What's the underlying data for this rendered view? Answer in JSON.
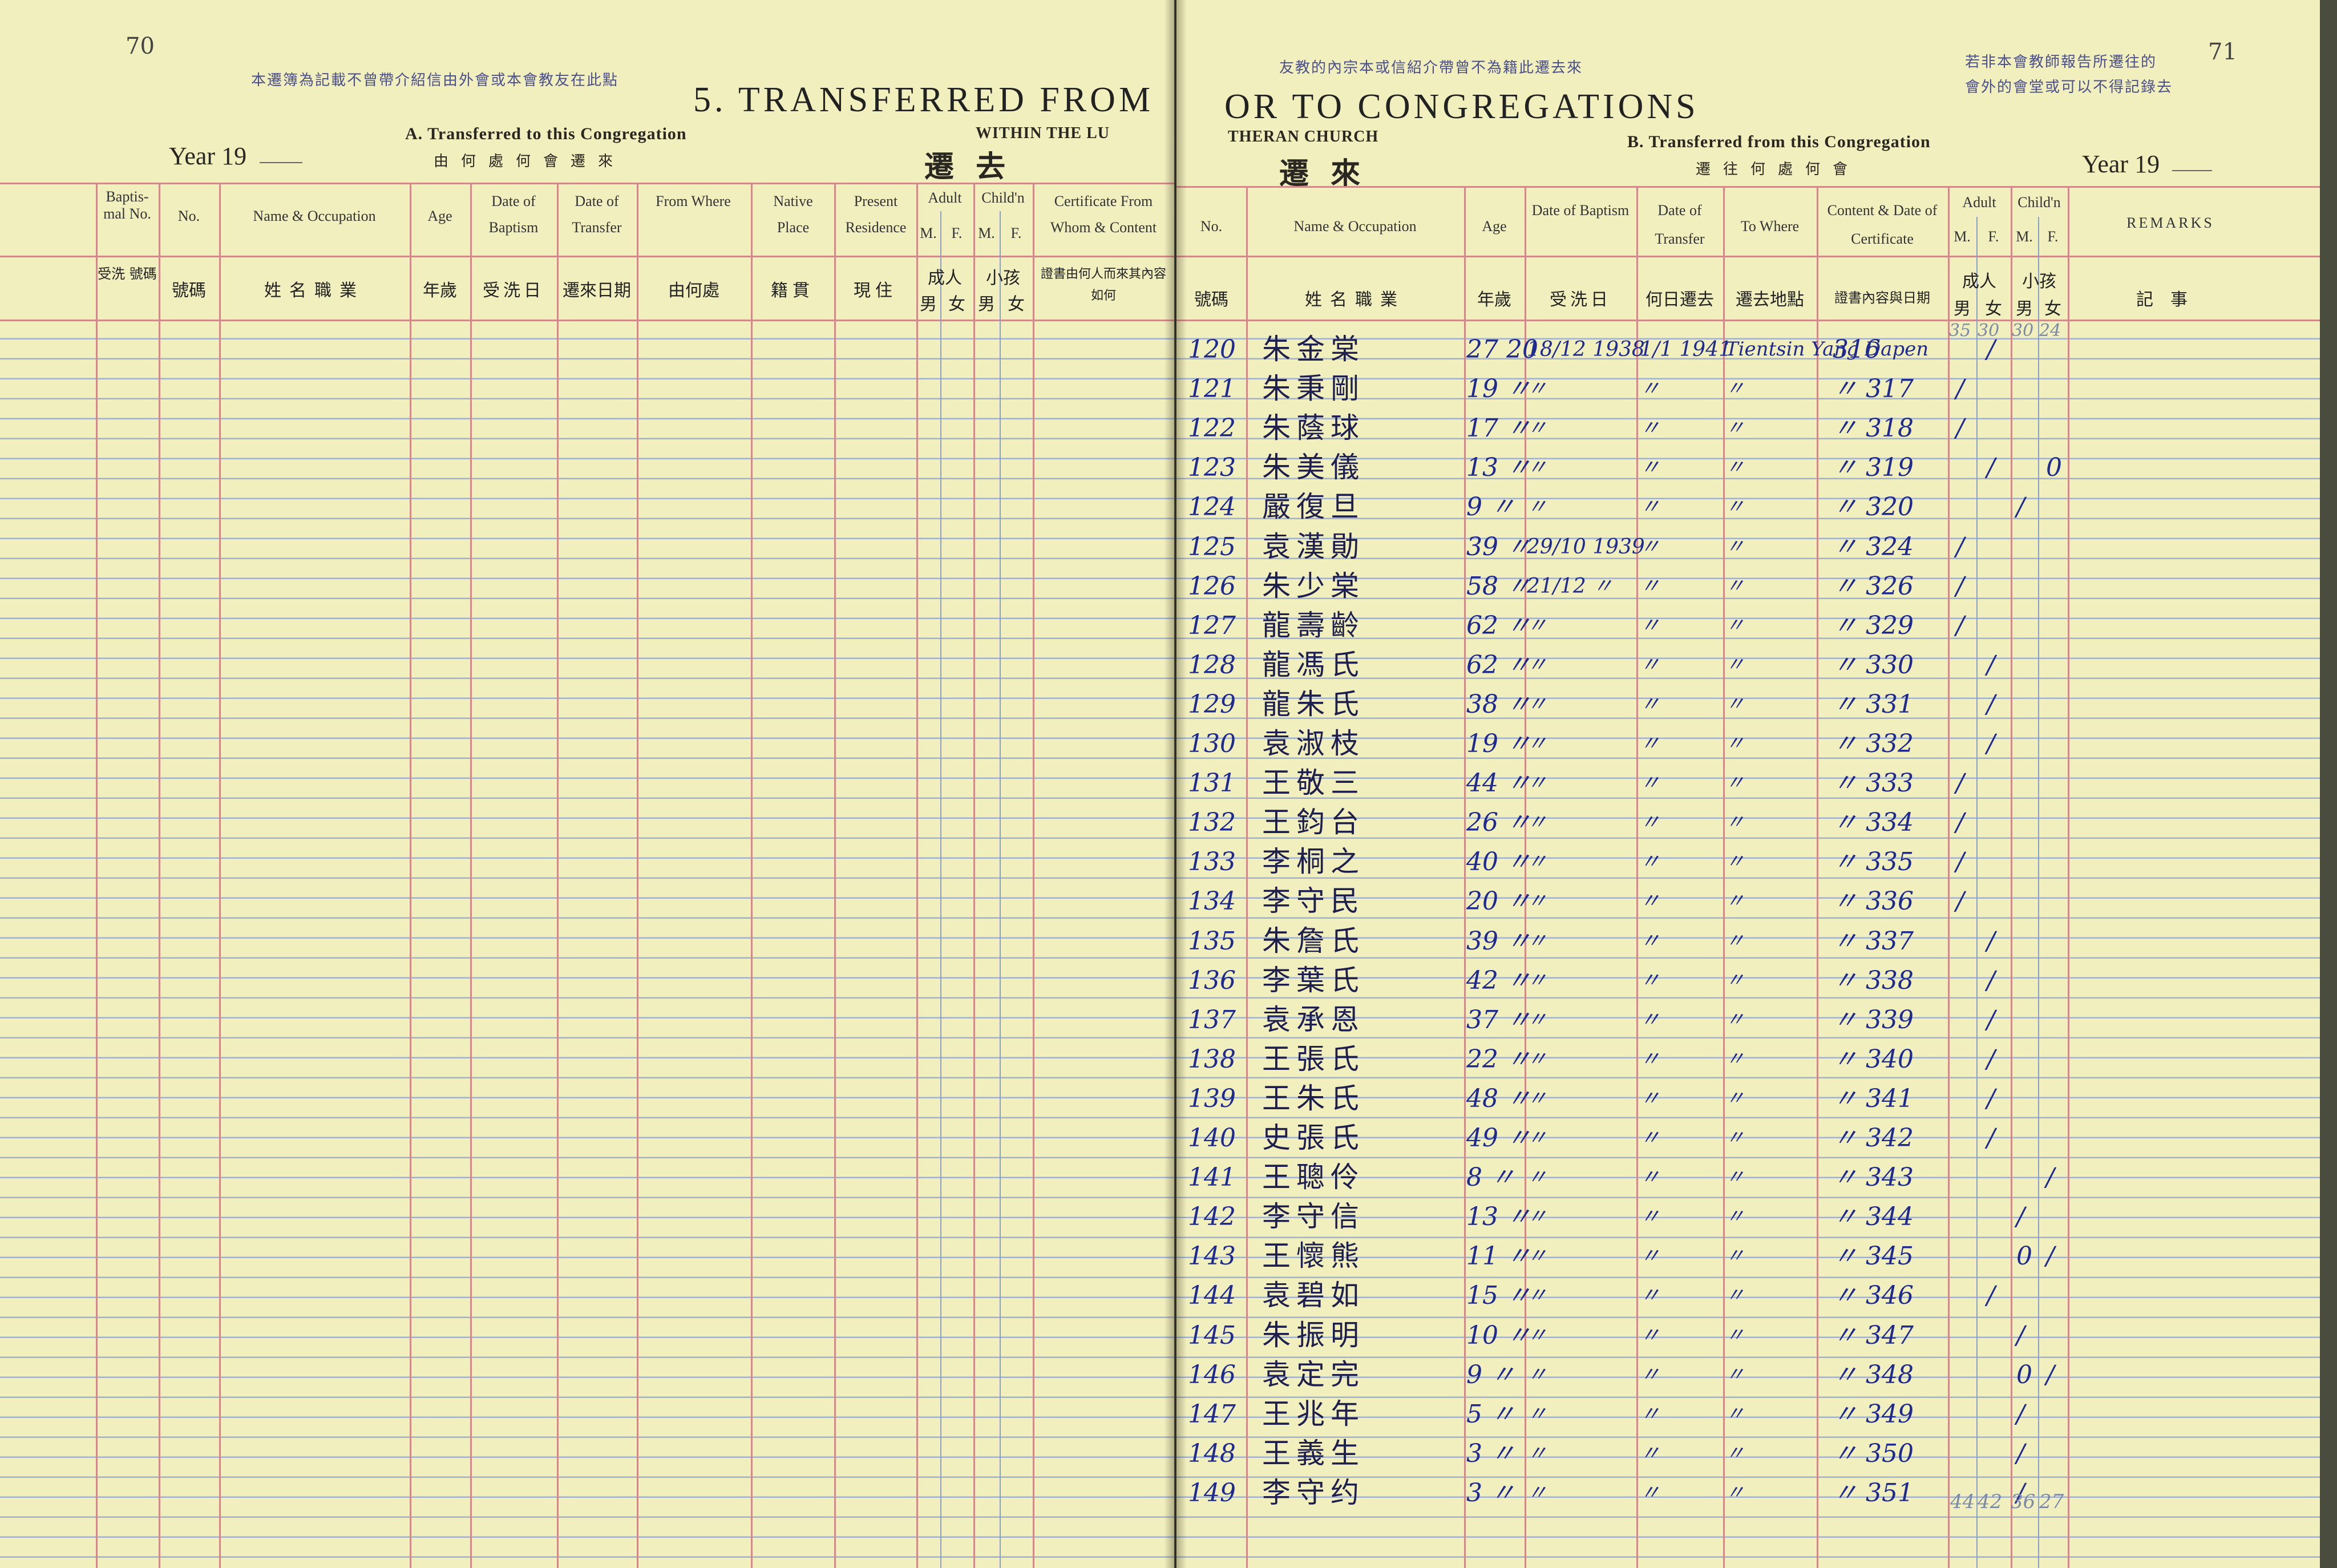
{
  "pages": {
    "left_number": "70",
    "right_number": "71"
  },
  "stamps": {
    "left": "本遷簿為記載不曾帶介紹信由外會或本會教友在此點",
    "middle": "友教的內宗本或信紹介帶曾不為籍此遷去來",
    "right_1": "若非本會教師報告所遷往的",
    "right_2": "會外的會堂或可以不得記錄去"
  },
  "title": {
    "left": "5. TRANSFERRED FROM",
    "right": "OR TO CONGREGATIONS",
    "within_left": "WITHIN THE LU",
    "within_right": "THERAN CHURCH"
  },
  "section_a": {
    "label": "A. Transferred to this Congregation",
    "label_cn": "由何處何會遷來",
    "big_cn": "遷 去"
  },
  "section_b": {
    "label": "B. Transferred from this Congregation",
    "label_cn": "遷往何處何會",
    "big_cn": "遷 來"
  },
  "year_label": "Year 19",
  "left_headers": [
    {
      "en": "Baptis- mal No.",
      "cn": "受洗 號碼"
    },
    {
      "en": "No.",
      "cn": "號碼"
    },
    {
      "en": "Name & Occupation",
      "cn": "姓名職業"
    },
    {
      "en": "Age",
      "cn": "年歲"
    },
    {
      "en": "Date of Baptism",
      "cn": "受洗日"
    },
    {
      "en": "Date of Transfer",
      "cn": "遷來日期"
    },
    {
      "en": "From Where",
      "cn": "由何處"
    },
    {
      "en": "Native Place",
      "cn": "籍貫"
    },
    {
      "en": "Present Residence",
      "cn": "現住"
    },
    {
      "en": "Adult",
      "cn": "成人"
    },
    {
      "en": "Child'n",
      "cn": "小孩"
    },
    {
      "en": "Certificate From Whom & Content",
      "cn": "證書由何人而來其內容如何"
    }
  ],
  "right_headers": [
    {
      "en": "No.",
      "cn": "號碼"
    },
    {
      "en": "Name & Occupation",
      "cn": "姓名職業"
    },
    {
      "en": "Age",
      "cn": "年歲"
    },
    {
      "en": "Date of Baptism",
      "cn": "受洗日"
    },
    {
      "en": "Date of Transfer",
      "cn": "何日遷去"
    },
    {
      "en": "To Where",
      "cn": "遷去地點"
    },
    {
      "en": "Content & Date of Certificate",
      "cn": "證書內容與日期"
    },
    {
      "en": "Adult",
      "cn": "成人"
    },
    {
      "en": "Child'n",
      "cn": "小孩"
    },
    {
      "en": "REMARKS",
      "cn": "記事"
    }
  ],
  "mf": {
    "m": "M.",
    "f": "F.",
    "male_cn": "男",
    "female_cn": "女"
  },
  "top_tally": [
    "35",
    "30",
    "30",
    "24"
  ],
  "entries": [
    {
      "no": "120",
      "name": "朱金棠",
      "age": "27 20",
      "bap": "18/12 1938",
      "trans": "1/1 1941",
      "to": "Tientsin Yang Dapen",
      "cert": "316",
      "am": "",
      "af": "/",
      "cm": "",
      "cf": ""
    },
    {
      "no": "121",
      "name": "朱秉剛",
      "age": "19 〃",
      "bap": "〃",
      "trans": "〃",
      "to": "〃",
      "cert": "〃 317",
      "am": "/",
      "af": "",
      "cm": "",
      "cf": ""
    },
    {
      "no": "122",
      "name": "朱蔭球",
      "age": "17 〃",
      "bap": "〃",
      "trans": "〃",
      "to": "〃",
      "cert": "〃 318",
      "am": "/",
      "af": "",
      "cm": "",
      "cf": ""
    },
    {
      "no": "123",
      "name": "朱美儀",
      "age": "13 〃",
      "bap": "〃",
      "trans": "〃",
      "to": "〃",
      "cert": "〃 319",
      "am": "",
      "af": "/",
      "cm": "",
      "cf": "0"
    },
    {
      "no": "124",
      "name": "嚴復旦",
      "age": "9 〃",
      "bap": "〃",
      "trans": "〃",
      "to": "〃",
      "cert": "〃 320",
      "am": "",
      "af": "",
      "cm": "/",
      "cf": ""
    },
    {
      "no": "125",
      "name": "袁漢勛",
      "age": "39 〃",
      "bap": "29/10 1939",
      "trans": "〃",
      "to": "〃",
      "cert": "〃 324",
      "am": "/",
      "af": "",
      "cm": "",
      "cf": ""
    },
    {
      "no": "126",
      "name": "朱少棠",
      "age": "58 〃",
      "bap": "21/12 〃",
      "trans": "〃",
      "to": "〃",
      "cert": "〃 326",
      "am": "/",
      "af": "",
      "cm": "",
      "cf": ""
    },
    {
      "no": "127",
      "name": "龍壽齡",
      "age": "62 〃",
      "bap": "〃",
      "trans": "〃",
      "to": "〃",
      "cert": "〃 329",
      "am": "/",
      "af": "",
      "cm": "",
      "cf": ""
    },
    {
      "no": "128",
      "name": "龍馮氏",
      "age": "62 〃",
      "bap": "〃",
      "trans": "〃",
      "to": "〃",
      "cert": "〃 330",
      "am": "",
      "af": "/",
      "cm": "",
      "cf": ""
    },
    {
      "no": "129",
      "name": "龍朱氏",
      "age": "38 〃",
      "bap": "〃",
      "trans": "〃",
      "to": "〃",
      "cert": "〃 331",
      "am": "",
      "af": "/",
      "cm": "",
      "cf": ""
    },
    {
      "no": "130",
      "name": "袁淑枝",
      "age": "19 〃",
      "bap": "〃",
      "trans": "〃",
      "to": "〃",
      "cert": "〃 332",
      "am": "",
      "af": "/",
      "cm": "",
      "cf": ""
    },
    {
      "no": "131",
      "name": "王敬三",
      "age": "44 〃",
      "bap": "〃",
      "trans": "〃",
      "to": "〃",
      "cert": "〃 333",
      "am": "/",
      "af": "",
      "cm": "",
      "cf": ""
    },
    {
      "no": "132",
      "name": "王鈞台",
      "age": "26 〃",
      "bap": "〃",
      "trans": "〃",
      "to": "〃",
      "cert": "〃 334",
      "am": "/",
      "af": "",
      "cm": "",
      "cf": ""
    },
    {
      "no": "133",
      "name": "李桐之",
      "age": "40 〃",
      "bap": "〃",
      "trans": "〃",
      "to": "〃",
      "cert": "〃 335",
      "am": "/",
      "af": "",
      "cm": "",
      "cf": ""
    },
    {
      "no": "134",
      "name": "李守民",
      "age": "20 〃",
      "bap": "〃",
      "trans": "〃",
      "to": "〃",
      "cert": "〃 336",
      "am": "/",
      "af": "",
      "cm": "",
      "cf": ""
    },
    {
      "no": "135",
      "name": "朱詹氏",
      "age": "39 〃",
      "bap": "〃",
      "trans": "〃",
      "to": "〃",
      "cert": "〃 337",
      "am": "",
      "af": "/",
      "cm": "",
      "cf": ""
    },
    {
      "no": "136",
      "name": "李葉氏",
      "age": "42 〃",
      "bap": "〃",
      "trans": "〃",
      "to": "〃",
      "cert": "〃 338",
      "am": "",
      "af": "/",
      "cm": "",
      "cf": ""
    },
    {
      "no": "137",
      "name": "袁承恩",
      "age": "37 〃",
      "bap": "〃",
      "trans": "〃",
      "to": "〃",
      "cert": "〃 339",
      "am": "",
      "af": "/",
      "cm": "",
      "cf": ""
    },
    {
      "no": "138",
      "name": "王張氏",
      "age": "22 〃",
      "bap": "〃",
      "trans": "〃",
      "to": "〃",
      "cert": "〃 340",
      "am": "",
      "af": "/",
      "cm": "",
      "cf": ""
    },
    {
      "no": "139",
      "name": "王朱氏",
      "age": "48 〃",
      "bap": "〃",
      "trans": "〃",
      "to": "〃",
      "cert": "〃 341",
      "am": "",
      "af": "/",
      "cm": "",
      "cf": ""
    },
    {
      "no": "140",
      "name": "史張氏",
      "age": "49 〃",
      "bap": "〃",
      "trans": "〃",
      "to": "〃",
      "cert": "〃 342",
      "am": "",
      "af": "/",
      "cm": "",
      "cf": ""
    },
    {
      "no": "141",
      "name": "王聰伶",
      "age": "8 〃",
      "bap": "〃",
      "trans": "〃",
      "to": "〃",
      "cert": "〃 343",
      "am": "",
      "af": "",
      "cm": "",
      "cf": "/"
    },
    {
      "no": "142",
      "name": "李守信",
      "age": "13 〃",
      "bap": "〃",
      "trans": "〃",
      "to": "〃",
      "cert": "〃 344",
      "am": "",
      "af": "",
      "cm": "/",
      "cf": ""
    },
    {
      "no": "143",
      "name": "王懷熊",
      "age": "11 〃",
      "bap": "〃",
      "trans": "〃",
      "to": "〃",
      "cert": "〃 345",
      "am": "",
      "af": "",
      "cm": "0",
      "cf": "/"
    },
    {
      "no": "144",
      "name": "袁碧如",
      "age": "15 〃",
      "bap": "〃",
      "trans": "〃",
      "to": "〃",
      "cert": "〃 346",
      "am": "",
      "af": "/",
      "cm": "",
      "cf": ""
    },
    {
      "no": "145",
      "name": "朱振明",
      "age": "10 〃",
      "bap": "〃",
      "trans": "〃",
      "to": "〃",
      "cert": "〃 347",
      "am": "",
      "af": "",
      "cm": "/",
      "cf": ""
    },
    {
      "no": "146",
      "name": "袁定完",
      "age": "9 〃",
      "bap": "〃",
      "trans": "〃",
      "to": "〃",
      "cert": "〃 348",
      "am": "",
      "af": "",
      "cm": "0",
      "cf": "/"
    },
    {
      "no": "147",
      "name": "王兆年",
      "age": "5 〃",
      "bap": "〃",
      "trans": "〃",
      "to": "〃",
      "cert": "〃 349",
      "am": "",
      "af": "",
      "cm": "/",
      "cf": ""
    },
    {
      "no": "148",
      "name": "王義生",
      "age": "3 〃",
      "bap": "〃",
      "trans": "〃",
      "to": "〃",
      "cert": "〃 350",
      "am": "",
      "af": "",
      "cm": "/",
      "cf": ""
    },
    {
      "no": "149",
      "name": "李守约",
      "age": "3 〃",
      "bap": "〃",
      "trans": "〃",
      "to": "〃",
      "cert": "〃 351",
      "am": "",
      "af": "",
      "cm": "/",
      "cf": ""
    }
  ],
  "bottom_tally": [
    "44",
    "42",
    "36",
    "27"
  ]
}
